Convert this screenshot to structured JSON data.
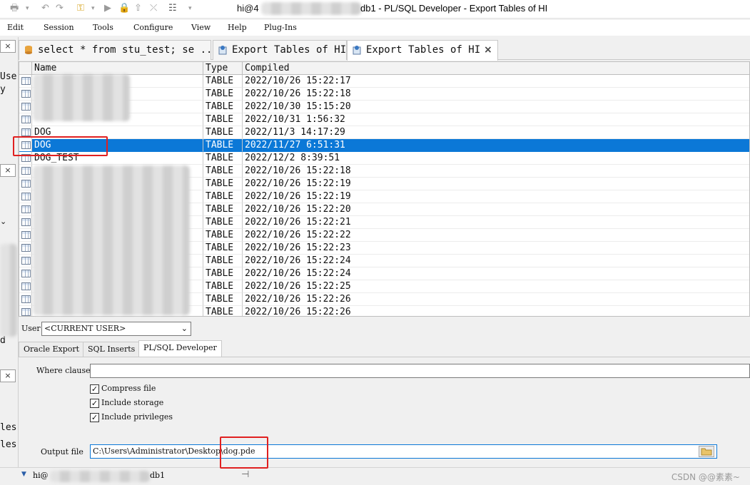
{
  "window": {
    "title_prefix": "hi@4",
    "title_suffix": "db1 - PL/SQL Developer - Export Tables of HI"
  },
  "menu": [
    "Edit",
    "Session",
    "Tools",
    "Configure",
    "View",
    "Help",
    "Plug-Ins"
  ],
  "left_panel": {
    "fragments": [
      "Use:",
      "y",
      "d",
      "les",
      "les"
    ]
  },
  "tabs": [
    {
      "label": "select * from stu_test; se ...",
      "active": false
    },
    {
      "label": "Export Tables of HI",
      "active": false
    },
    {
      "label": "Export Tables of HI",
      "active": true,
      "close": "×"
    }
  ],
  "grid": {
    "columns": [
      "Name",
      "Type",
      "Compiled"
    ],
    "rows": [
      {
        "name": "",
        "type": "TABLE",
        "compiled": "2022/10/26 15:22:17"
      },
      {
        "name": "",
        "type": "TABLE",
        "compiled": "2022/10/26 15:22:18"
      },
      {
        "name": "",
        "type": "TABLE",
        "compiled": "2022/10/30 15:15:20"
      },
      {
        "name": "",
        "type": "TABLE",
        "compiled": "2022/10/31 1:56:32"
      },
      {
        "name": "DOG",
        "type": "TABLE",
        "compiled": "2022/11/3 14:17:29"
      },
      {
        "name": "DOG",
        "type": "TABLE",
        "compiled": "2022/11/27 6:51:31",
        "selected": true
      },
      {
        "name": "DOG_TEST",
        "type": "TABLE",
        "compiled": "2022/12/2 8:39:51"
      },
      {
        "name": "",
        "type": "TABLE",
        "compiled": "2022/10/26 15:22:18"
      },
      {
        "name": "",
        "type": "TABLE",
        "compiled": "2022/10/26 15:22:19"
      },
      {
        "name": "",
        "type": "TABLE",
        "compiled": "2022/10/26 15:22:19"
      },
      {
        "name": "",
        "type": "TABLE",
        "compiled": "2022/10/26 15:22:20"
      },
      {
        "name": "",
        "type": "TABLE",
        "compiled": "2022/10/26 15:22:21"
      },
      {
        "name": "",
        "type": "TABLE",
        "compiled": "2022/10/26 15:22:22"
      },
      {
        "name": "",
        "type": "TABLE",
        "compiled": "2022/10/26 15:22:23"
      },
      {
        "name": "",
        "type": "TABLE",
        "compiled": "2022/10/26 15:22:24"
      },
      {
        "name": "",
        "type": "TABLE",
        "compiled": "2022/10/26 15:22:24"
      },
      {
        "name": "",
        "type": "TABLE",
        "compiled": "2022/10/26 15:22:25"
      },
      {
        "name": "",
        "type": "TABLE",
        "compiled": "2022/10/26 15:22:26"
      },
      {
        "name": "",
        "type": "TABLE",
        "compiled": "2022/10/26 15:22:26"
      }
    ]
  },
  "form": {
    "user_label": "User",
    "user_value": "<CURRENT USER>",
    "subtabs": [
      "Oracle Export",
      "SQL Inserts",
      "PL/SQL Developer"
    ],
    "where_label": "Where clause",
    "where_value": "",
    "checkboxes": [
      {
        "label": "Compress file",
        "checked": true
      },
      {
        "label": "Include storage",
        "checked": true
      },
      {
        "label": "Include privileges",
        "checked": true
      }
    ],
    "output_label": "Output file",
    "output_value": "C:\\Users\\Administrator\\Desktop\\dog.pde"
  },
  "status": {
    "conn_prefix": "hi@",
    "conn_suffix": "db1",
    "watermark": "CSDN @@素素~"
  },
  "colors": {
    "selection": "#0b78d7",
    "annotation": "#e02020"
  },
  "icons": {
    "checkmark": "✓",
    "dropdown": "⌄",
    "close": "×",
    "status_arrow": "▼"
  }
}
